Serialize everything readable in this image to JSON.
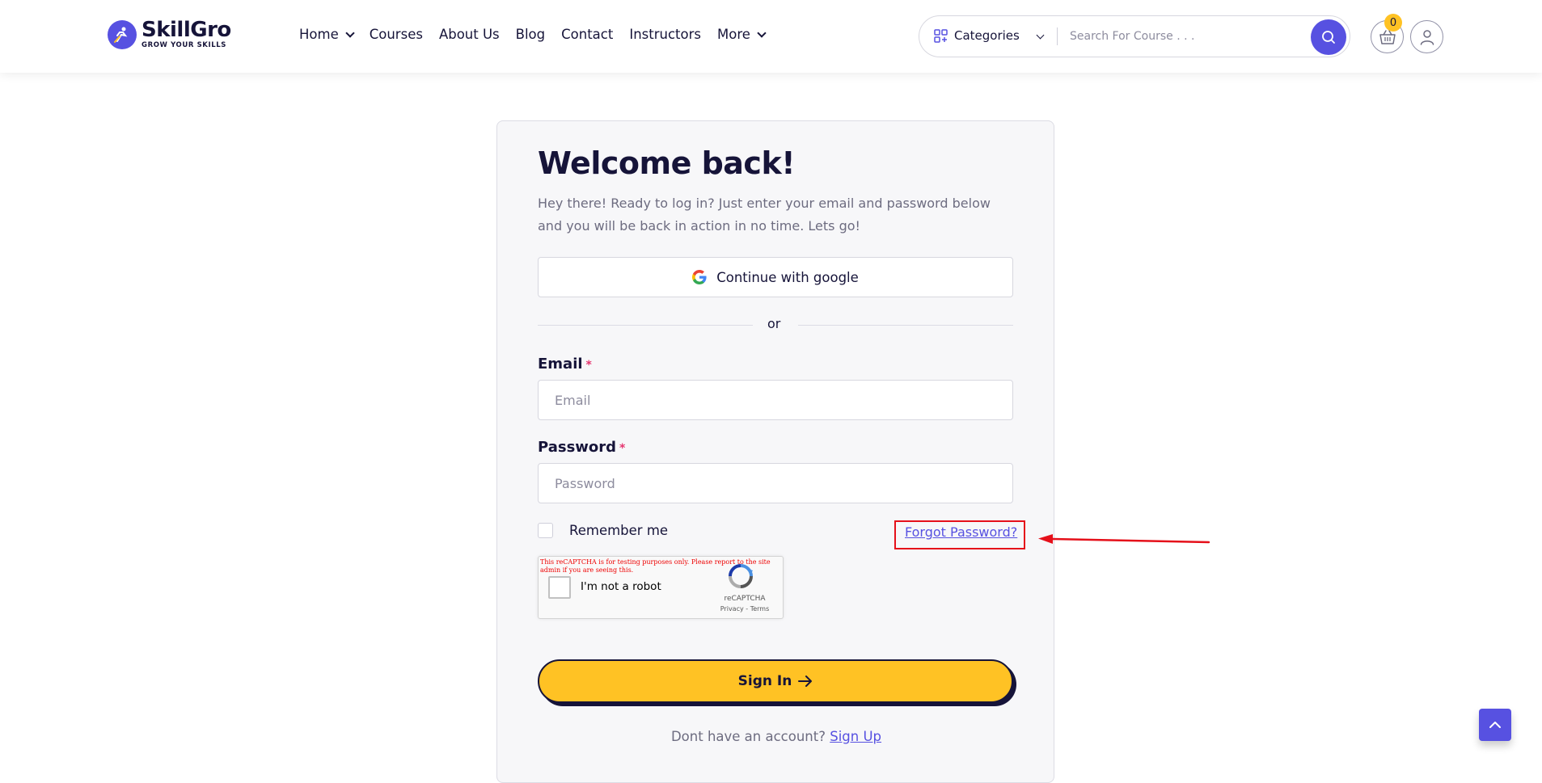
{
  "header": {
    "logo": {
      "name": "SkillGro",
      "tagline": "GROW YOUR SKILLS"
    },
    "nav": [
      {
        "label": "Home",
        "dropdown": true
      },
      {
        "label": "Courses",
        "dropdown": false
      },
      {
        "label": "About Us",
        "dropdown": false
      },
      {
        "label": "Blog",
        "dropdown": false
      },
      {
        "label": "Contact",
        "dropdown": false
      },
      {
        "label": "Instructors",
        "dropdown": false
      },
      {
        "label": "More",
        "dropdown": true
      }
    ],
    "categories_label": "Categories",
    "search_placeholder": "Search For Course . . .",
    "cart_count": "0"
  },
  "login": {
    "title": "Welcome back!",
    "intro": "Hey there! Ready to log in? Just enter your email and password below and you will be back in action in no time. Lets go!",
    "google_label": "Continue with google",
    "or_label": "or",
    "email_label": "Email",
    "email_placeholder": "Email",
    "password_label": "Password",
    "password_placeholder": "Password",
    "required_mark": "*",
    "remember_label": "Remember me",
    "forgot_label": "Forgot Password?",
    "signin_label": "Sign In",
    "signup_prompt": "Dont have an account?",
    "signup_label": "Sign Up"
  },
  "recaptcha": {
    "warning": "This reCAPTCHA is for testing purposes only. Please report to the site admin if you are seeing this.",
    "label": "I'm not a robot",
    "brand": "reCAPTCHA",
    "links": "Privacy - Terms"
  },
  "colors": {
    "primary": "#5751e1",
    "accent_yellow": "#ffc224",
    "heading": "#161439",
    "annotation_red": "#e5101a"
  }
}
